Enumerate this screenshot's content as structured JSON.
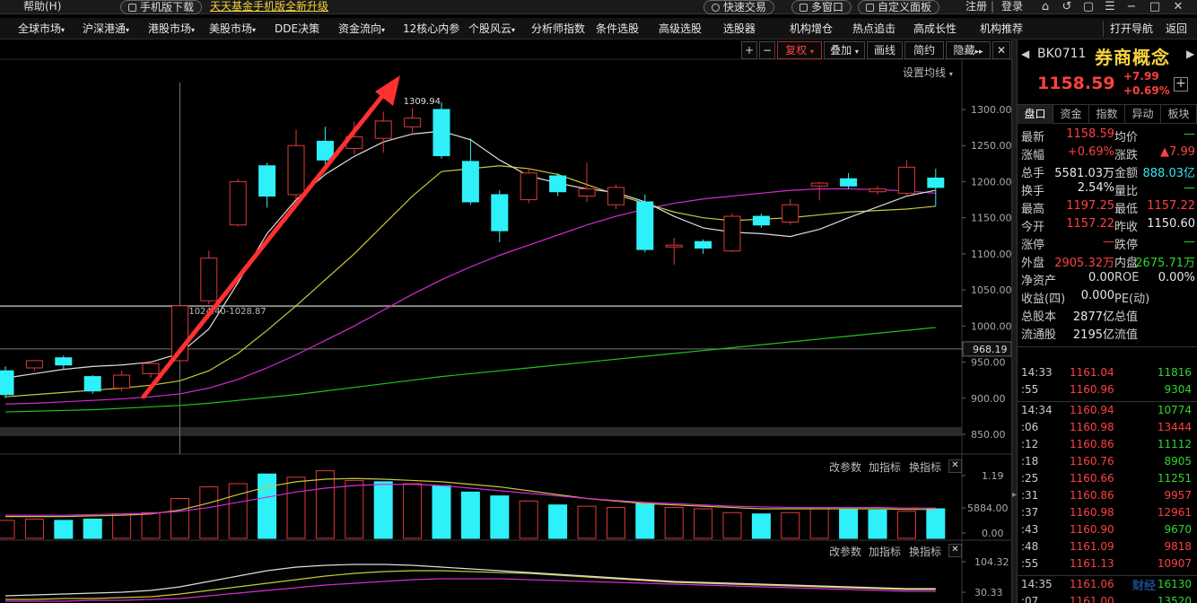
{
  "topbar": {
    "help": "帮助(H)",
    "mobile_download": "手机版下载",
    "fund_link": "天天基金手机版全新升级",
    "quick_trade": "快速交易",
    "multi_window": "多窗口",
    "custom_panel": "自定义面板",
    "register": "注册",
    "login": "登录"
  },
  "nav": {
    "items": [
      "全球市场",
      "沪深港通",
      "港股市场",
      "美股市场",
      "DDE决策",
      "资金流向",
      "12核心内参",
      "个股风云",
      "分析师指数",
      "条件选股",
      "高级选股",
      "选股器",
      "机构增仓",
      "热点追击",
      "高成长性",
      "机构推荐"
    ],
    "right": [
      "打开导航",
      "返回"
    ]
  },
  "toolbar": {
    "plus": "+",
    "minus": "−",
    "fuquan": "复权",
    "diejia": "叠加",
    "huaxian": "画线",
    "jianyue": "简约",
    "yincang": "隐藏",
    "settings_ma": "设置均线"
  },
  "chart_data": [
    {
      "type": "candlestick",
      "y_ticks": [
        "1300.00",
        "1250.00",
        "1200.00",
        "1150.00",
        "1100.00",
        "1050.00",
        "1000.00",
        "950.00",
        "900.00",
        "850.00"
      ],
      "y_values": [
        1300,
        1250,
        1200,
        1150,
        1100,
        1050,
        1000,
        950,
        900,
        850
      ],
      "current_price_label": "968.19",
      "annotations": {
        "high": "1309.94",
        "range": "1024.40-1028.87"
      },
      "candles": [
        {
          "o": 938,
          "c": 905,
          "h": 944,
          "l": 900
        },
        {
          "o": 942,
          "c": 952,
          "h": 953,
          "l": 938
        },
        {
          "o": 956,
          "c": 946,
          "h": 959,
          "l": 940
        },
        {
          "o": 930,
          "c": 910,
          "h": 932,
          "l": 906
        },
        {
          "o": 914,
          "c": 932,
          "h": 938,
          "l": 910
        },
        {
          "o": 934,
          "c": 948,
          "h": 952,
          "l": 928
        },
        {
          "o": 952,
          "c": 1028,
          "h": 1030,
          "l": 950
        },
        {
          "o": 1035,
          "c": 1094,
          "h": 1104,
          "l": 1030
        },
        {
          "o": 1140,
          "c": 1200,
          "h": 1204,
          "l": 1138
        },
        {
          "o": 1222,
          "c": 1180,
          "h": 1226,
          "l": 1164
        },
        {
          "o": 1182,
          "c": 1250,
          "h": 1272,
          "l": 1175
        },
        {
          "o": 1256,
          "c": 1230,
          "h": 1276,
          "l": 1224
        },
        {
          "o": 1246,
          "c": 1262,
          "h": 1283,
          "l": 1238
        },
        {
          "o": 1260,
          "c": 1284,
          "h": 1297,
          "l": 1240
        },
        {
          "o": 1276,
          "c": 1288,
          "h": 1302,
          "l": 1264
        },
        {
          "o": 1300,
          "c": 1236,
          "h": 1310,
          "l": 1232
        },
        {
          "o": 1228,
          "c": 1172,
          "h": 1260,
          "l": 1168
        },
        {
          "o": 1182,
          "c": 1132,
          "h": 1188,
          "l": 1116
        },
        {
          "o": 1175,
          "c": 1212,
          "h": 1218,
          "l": 1170
        },
        {
          "o": 1208,
          "c": 1186,
          "h": 1212,
          "l": 1180
        },
        {
          "o": 1180,
          "c": 1190,
          "h": 1226,
          "l": 1172
        },
        {
          "o": 1168,
          "c": 1192,
          "h": 1196,
          "l": 1162
        },
        {
          "o": 1172,
          "c": 1106,
          "h": 1182,
          "l": 1102
        },
        {
          "o": 1112,
          "c": 1112,
          "h": 1122,
          "l": 1085
        },
        {
          "o": 1117,
          "c": 1108,
          "h": 1120,
          "l": 1100
        },
        {
          "o": 1104,
          "c": 1152,
          "h": 1156,
          "l": 1102
        },
        {
          "o": 1152,
          "c": 1140,
          "h": 1156,
          "l": 1136
        },
        {
          "o": 1144,
          "c": 1168,
          "h": 1176,
          "l": 1140
        },
        {
          "o": 1194,
          "c": 1198,
          "h": 1200,
          "l": 1174
        },
        {
          "o": 1204,
          "c": 1194,
          "h": 1212,
          "l": 1190
        },
        {
          "o": 1186,
          "c": 1190,
          "h": 1194,
          "l": 1182
        },
        {
          "o": 1184,
          "c": 1220,
          "h": 1230,
          "l": 1180
        },
        {
          "o": 1205,
          "c": 1192,
          "h": 1218,
          "l": 1166
        }
      ],
      "ma_white": [
        928,
        934,
        940,
        944,
        946,
        950,
        962,
        996,
        1060,
        1128,
        1175,
        1210,
        1235,
        1255,
        1266,
        1270,
        1258,
        1230,
        1208,
        1198,
        1190,
        1185,
        1172,
        1152,
        1136,
        1130,
        1128,
        1124,
        1134,
        1150,
        1165,
        1180,
        1188
      ],
      "ma_yellow": [
        902,
        905,
        908,
        911,
        914,
        918,
        924,
        938,
        962,
        994,
        1028,
        1064,
        1100,
        1140,
        1180,
        1214,
        1218,
        1222,
        1218,
        1210,
        1196,
        1182,
        1170,
        1158,
        1150,
        1146,
        1148,
        1150,
        1154,
        1158,
        1160,
        1162,
        1166
      ],
      "ma_magenta": [
        892,
        893,
        895,
        897,
        899,
        902,
        906,
        914,
        926,
        942,
        960,
        980,
        1000,
        1022,
        1044,
        1064,
        1082,
        1098,
        1112,
        1126,
        1140,
        1152,
        1162,
        1170,
        1176,
        1180,
        1184,
        1188,
        1190,
        1190,
        1189,
        1187,
        1184
      ],
      "ma_green": [
        881,
        882,
        883,
        884,
        886,
        888,
        890,
        893,
        897,
        901,
        905,
        910,
        915,
        920,
        925,
        930,
        934,
        938,
        942,
        946,
        950,
        954,
        958,
        962,
        966,
        970,
        974,
        978,
        982,
        986,
        990,
        994,
        998
      ]
    },
    {
      "type": "bar",
      "labels": [
        "改参数",
        "加指标",
        "换指标"
      ],
      "y_ticks": [
        "1.19",
        "5884.00",
        "0.00"
      ],
      "volumes": [
        0.28,
        0.3,
        0.28,
        0.3,
        0.38,
        0.4,
        0.62,
        0.8,
        0.85,
        1.0,
        0.95,
        1.05,
        0.9,
        0.88,
        0.85,
        0.82,
        0.72,
        0.66,
        0.58,
        0.52,
        0.5,
        0.48,
        0.54,
        0.48,
        0.46,
        0.4,
        0.38,
        0.4,
        0.48,
        0.46,
        0.44,
        0.42,
        0.46
      ],
      "vol_dir": [
        "r",
        "r",
        "c",
        "c",
        "r",
        "r",
        "r",
        "r",
        "r",
        "c",
        "r",
        "r",
        "r",
        "c",
        "r",
        "c",
        "c",
        "c",
        "r",
        "c",
        "r",
        "r",
        "c",
        "r",
        "r",
        "r",
        "c",
        "r",
        "r",
        "c",
        "c",
        "r",
        "c"
      ]
    },
    {
      "type": "line",
      "labels": [
        "改参数",
        "加指标",
        "换指标"
      ],
      "y_ticks": [
        "104.32",
        "30.33"
      ]
    }
  ],
  "rp": {
    "code": "BK0711",
    "name": "券商概念",
    "price": "1158.59",
    "chg": "+7.99",
    "chg_pct": "+0.69%",
    "plus": "+",
    "tabs": [
      "盘口",
      "资金",
      "指数",
      "异动",
      "板块"
    ],
    "rows": [
      {
        "l1": "最新",
        "v1": "1158.59",
        "c1": "red-t",
        "l2": "均价",
        "v2": "—",
        "c2": "green-t"
      },
      {
        "l1": "涨幅",
        "v1": "+0.69%",
        "c1": "red-t",
        "l2": "涨跌",
        "v2": "▲7.99",
        "c2": "red-t"
      },
      {
        "l1": "总手",
        "v1": "5581.03万",
        "c1": "white-t",
        "l2": "金额",
        "v2": "888.03亿",
        "c2": "cyan-t"
      },
      {
        "l1": "换手",
        "v1": "2.54%",
        "c1": "white-t",
        "l2": "量比",
        "v2": "—",
        "c2": "green-t"
      },
      {
        "l1": "最高",
        "v1": "1197.25",
        "c1": "red-t",
        "l2": "最低",
        "v2": "1157.22",
        "c2": "red-t"
      },
      {
        "l1": "今开",
        "v1": "1157.22",
        "c1": "red-t",
        "l2": "昨收",
        "v2": "1150.60",
        "c2": "white-t"
      },
      {
        "l1": "涨停",
        "v1": "—",
        "c1": "red-t",
        "l2": "跌停",
        "v2": "—",
        "c2": "green-t"
      },
      {
        "l1": "外盘",
        "v1": "2905.32万",
        "c1": "red-t",
        "l2": "内盘",
        "v2": "2675.71万",
        "c2": "green-t"
      },
      {
        "l1": "净资产",
        "v1": "0.00",
        "c1": "white-t",
        "l2": "ROE",
        "v2": "0.00%",
        "c2": "white-t"
      },
      {
        "l1": "收益(四)",
        "v1": "0.000",
        "c1": "white-t",
        "l2": "PE(动)",
        "v2": "",
        "c2": "white-t"
      },
      {
        "l1": "总股本",
        "v1": "2877亿",
        "c1": "white-t",
        "l2": "总值",
        "v2": "",
        "c2": "white-t"
      },
      {
        "l1": "流通股",
        "v1": "2195亿",
        "c1": "white-t",
        "l2": "流值",
        "v2": "",
        "c2": "white-t"
      }
    ],
    "ticks": [
      {
        "t": "14:33",
        "p": "1161.04",
        "v": "11816",
        "c": "green-t"
      },
      {
        "t": ":55",
        "p": "1160.96",
        "v": "9304",
        "c": "green-t"
      },
      {
        "t": "14:34",
        "p": "1160.94",
        "v": "10774",
        "c": "green-t"
      },
      {
        "t": ":06",
        "p": "1160.98",
        "v": "13444",
        "c": "red-t"
      },
      {
        "t": ":12",
        "p": "1160.86",
        "v": "11112",
        "c": "green-t"
      },
      {
        "t": ":18",
        "p": "1160.76",
        "v": "8905",
        "c": "green-t"
      },
      {
        "t": ":25",
        "p": "1160.66",
        "v": "11251",
        "c": "green-t"
      },
      {
        "t": ":31",
        "p": "1160.86",
        "v": "9957",
        "c": "red-t"
      },
      {
        "t": ":37",
        "p": "1160.98",
        "v": "12961",
        "c": "red-t"
      },
      {
        "t": ":43",
        "p": "1160.90",
        "v": "9670",
        "c": "green-t"
      },
      {
        "t": ":48",
        "p": "1161.09",
        "v": "9818",
        "c": "red-t"
      },
      {
        "t": ":55",
        "p": "1161.13",
        "v": "10907",
        "c": "red-t"
      },
      {
        "t": "14:35",
        "p": "1161.06",
        "v": "16130",
        "c": "green-t"
      },
      {
        "t": ":07",
        "p": "1161.00",
        "v": "13520",
        "c": "green-t"
      }
    ]
  },
  "watermark": "财经"
}
